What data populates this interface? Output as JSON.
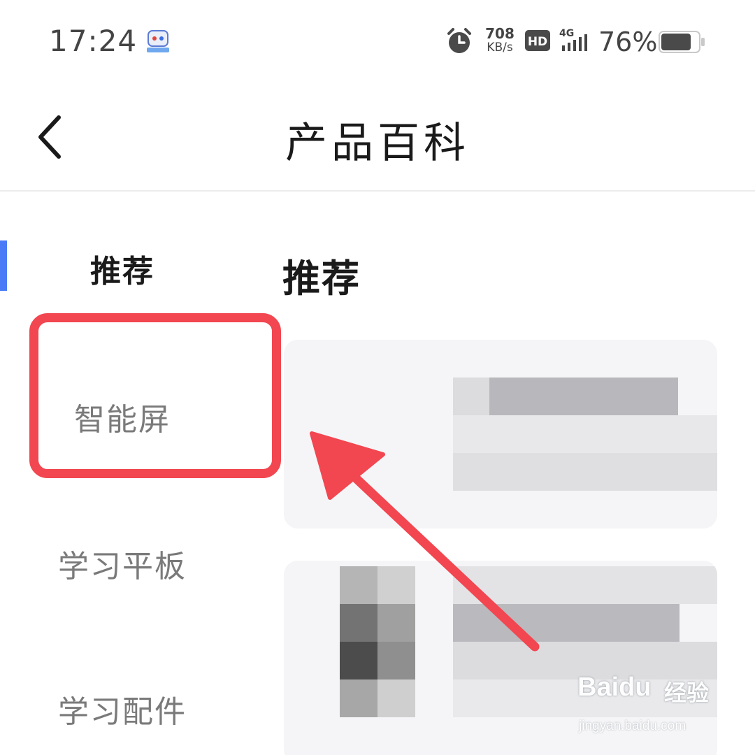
{
  "status_bar": {
    "time": "17:24",
    "speed_value": "708",
    "speed_unit": "KB/s",
    "network": "4G",
    "battery_percent": "76%",
    "icons": [
      "app-robot-icon",
      "alarm-icon",
      "hd-icon",
      "signal-4g-icon",
      "battery-icon"
    ]
  },
  "header": {
    "title": "产品百科",
    "back_icon": "chevron-left-icon"
  },
  "sidebar": {
    "items": [
      {
        "label": "推荐",
        "active": true
      },
      {
        "label": "智能屏",
        "active": false
      },
      {
        "label": "学习平板",
        "active": false
      },
      {
        "label": "学习配件",
        "active": false
      }
    ],
    "indicator_color": "#4a7bf7"
  },
  "main": {
    "section_title": "推荐",
    "cards_content": "pixelated/blurred"
  },
  "annotation": {
    "highlight_color": "#f24650",
    "highlight_target": "智能屏",
    "arrow_color": "#f24650"
  },
  "watermark": {
    "brand": "Baidu",
    "product": "经验",
    "url": "jingyan.baidu.com"
  }
}
